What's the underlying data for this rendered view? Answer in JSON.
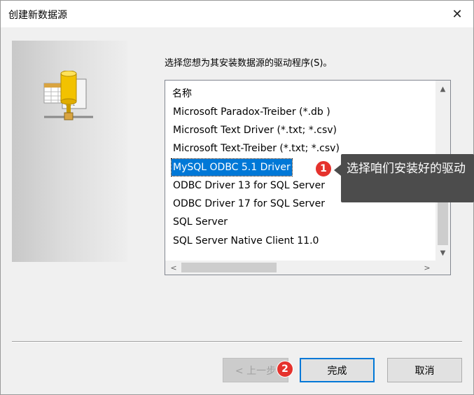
{
  "window": {
    "title": "创建新数据源",
    "close_glyph": "✕"
  },
  "prompt": "选择您想为其安装数据源的驱动程序(S)。",
  "list": {
    "header": "名称",
    "items": [
      "Microsoft Paradox-Treiber (*.db )",
      "Microsoft Text Driver (*.txt; *.csv)",
      "Microsoft Text-Treiber (*.txt; *.csv)",
      "MySQL ODBC 5.1 Driver",
      "ODBC Driver 13 for SQL Server",
      "ODBC Driver 17 for SQL Server",
      "SQL Server",
      "SQL Server Native Client 11.0"
    ],
    "selected": "MySQL ODBC 5.1 Driver"
  },
  "annotations": {
    "badge1": "1",
    "badge2": "2",
    "tooltip": "选择咱们安装好的驱动"
  },
  "buttons": {
    "back": "< 上一步",
    "finish": "完成",
    "cancel": "取消"
  },
  "colors": {
    "selection": "#0078d7",
    "badge": "#e5322d",
    "tooltip_bg": "#4c4c4c"
  }
}
